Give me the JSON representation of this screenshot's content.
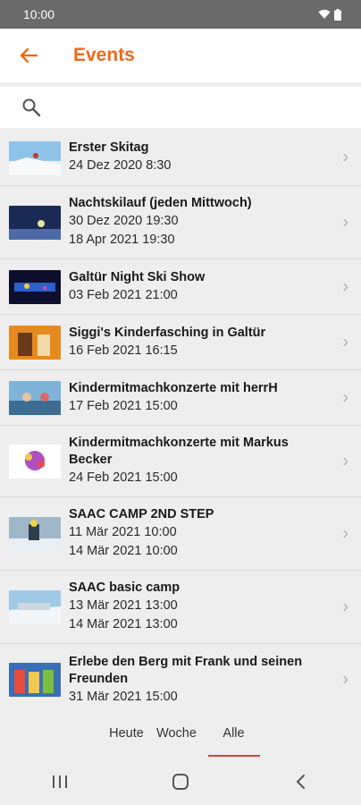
{
  "status": {
    "time": "10:00"
  },
  "header": {
    "title": "Events",
    "back_icon": "arrow-left-icon"
  },
  "search": {
    "placeholder": "",
    "value": ""
  },
  "events": [
    {
      "title": "Erster Skitag",
      "dates": [
        "24 Dez 2020 8:30"
      ]
    },
    {
      "title": "Nachtskilauf (jeden Mittwoch)",
      "dates": [
        "30 Dez 2020 19:30",
        "18 Apr 2021 19:30"
      ]
    },
    {
      "title": "Galtür Night Ski Show",
      "dates": [
        "03 Feb 2021 21:00"
      ]
    },
    {
      "title": "Siggi's Kinderfasching in Galtür",
      "dates": [
        "16 Feb 2021 16:15"
      ]
    },
    {
      "title": "Kindermitmachkonzerte mit herrH",
      "dates": [
        "17 Feb 2021 15:00"
      ]
    },
    {
      "title": "Kindermitmachkonzerte mit Markus Becker",
      "dates": [
        "24 Feb 2021 15:00"
      ]
    },
    {
      "title": "SAAC CAMP 2ND STEP",
      "dates": [
        "11 Mär 2021 10:00",
        "14 Mär 2021 10:00"
      ]
    },
    {
      "title": "SAAC basic camp",
      "dates": [
        "13 Mär 2021 13:00",
        "14 Mär 2021 13:00"
      ]
    },
    {
      "title": "Erlebe den Berg mit Frank und seinen Freunden",
      "dates": [
        "31 Mär 2021 15:00"
      ]
    }
  ],
  "tabs": [
    {
      "label": "Heute",
      "active": false
    },
    {
      "label": "Woche",
      "active": false
    },
    {
      "label": "Alle",
      "active": true
    }
  ],
  "colors": {
    "accent": "#ee6a1a",
    "tab_indicator": "#e33b3b"
  }
}
